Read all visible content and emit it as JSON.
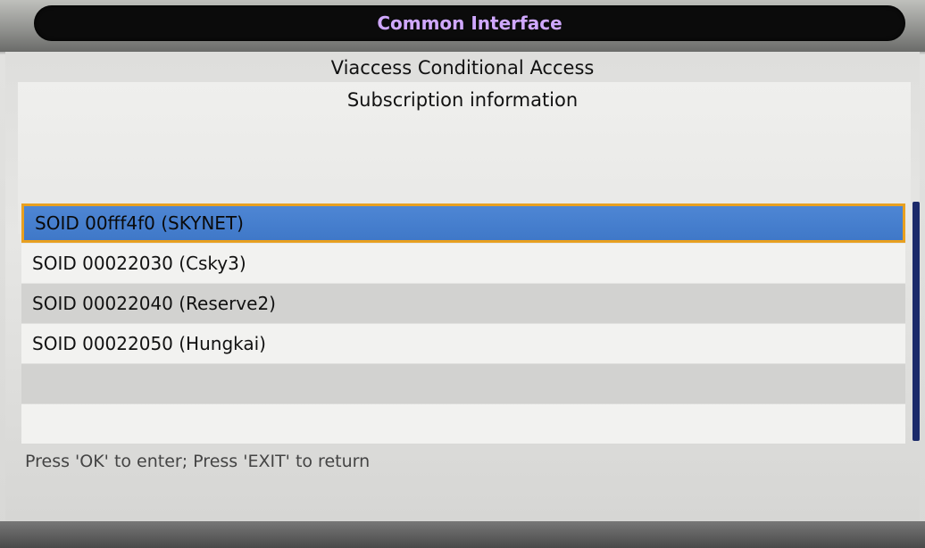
{
  "window": {
    "title": "Common Interface"
  },
  "header": {
    "module_title": "Viaccess Conditional Access",
    "section_title": "Subscription information"
  },
  "list": {
    "items": [
      {
        "label": "SOID 00fff4f0 (SKYNET)",
        "selected": true
      },
      {
        "label": "SOID 00022030 (Csky3)",
        "selected": false
      },
      {
        "label": "SOID 00022040 (Reserve2)",
        "selected": false
      },
      {
        "label": "SOID 00022050 (Hungkai)",
        "selected": false
      },
      {
        "label": "",
        "selected": false
      },
      {
        "label": "",
        "selected": false
      }
    ]
  },
  "footer": {
    "hint": "Press 'OK' to enter; Press 'EXIT' to return"
  },
  "colors": {
    "title_text": "#d0a8ff",
    "selection_fill": "#4680cf",
    "selection_border": "#e8a020",
    "scrollbar": "#1b2a6a"
  }
}
